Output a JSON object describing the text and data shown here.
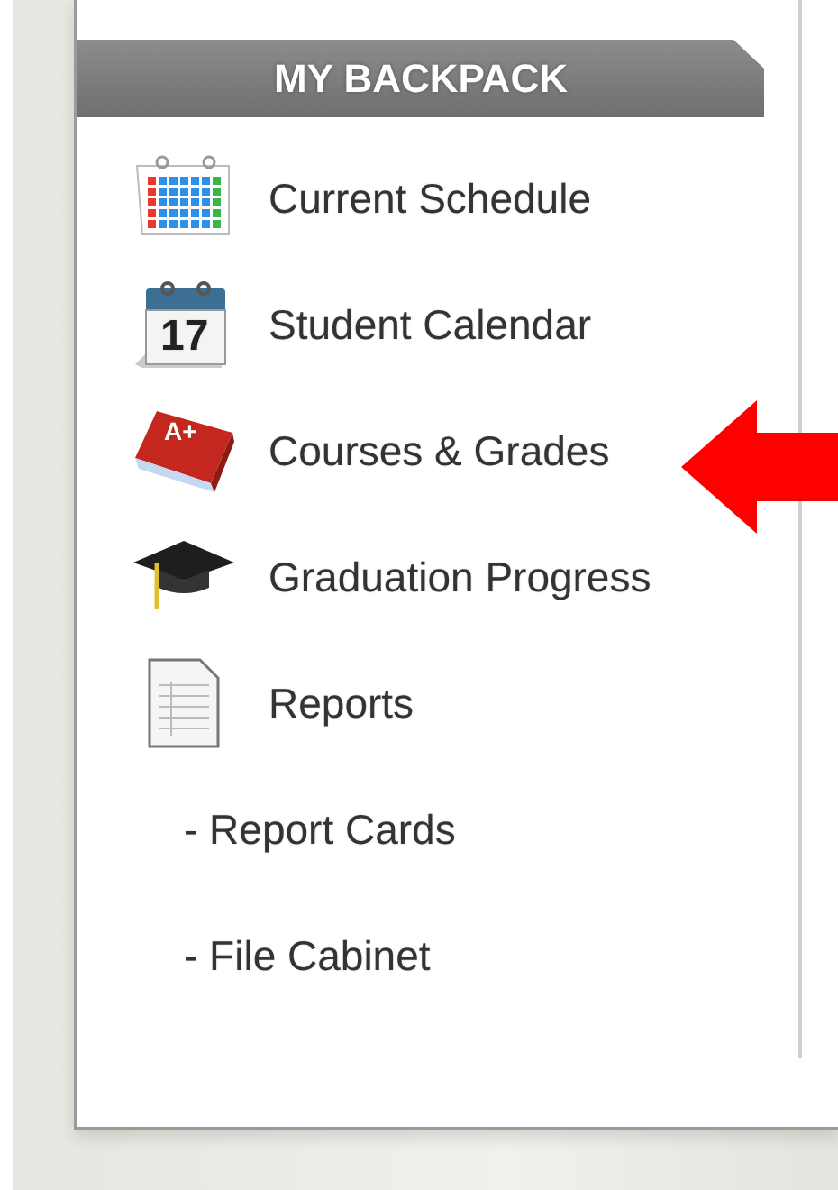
{
  "sidebar": {
    "title": "MY BACKPACK",
    "items": [
      {
        "label": "Current Schedule",
        "kind": "schedule"
      },
      {
        "label": "Student Calendar",
        "kind": "calendar",
        "icon_text": "17"
      },
      {
        "label": "Courses & Grades",
        "kind": "grades",
        "icon_text": "A+"
      },
      {
        "label": "Graduation Progress",
        "kind": "graduation"
      },
      {
        "label": "Reports",
        "kind": "reports"
      },
      {
        "label": "- Report Cards",
        "kind": "subitem"
      },
      {
        "label": "- File Cabinet",
        "kind": "subitem"
      }
    ]
  }
}
